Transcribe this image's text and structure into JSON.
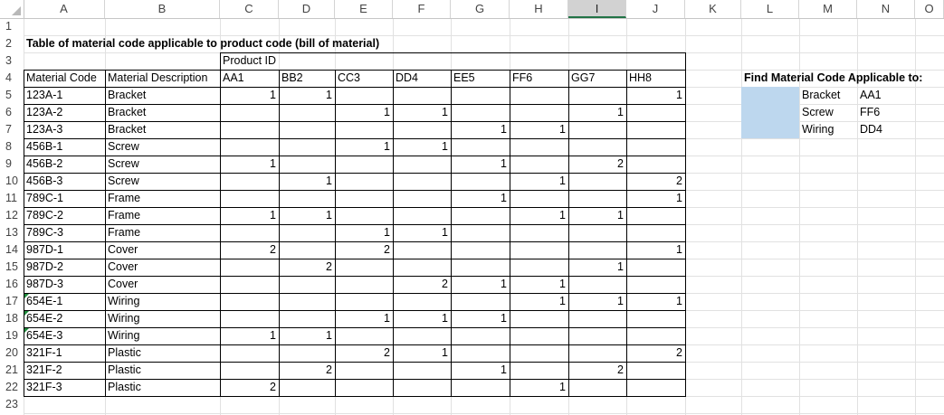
{
  "columns": [
    "A",
    "B",
    "C",
    "D",
    "E",
    "F",
    "G",
    "H",
    "I",
    "J",
    "K",
    "L",
    "M",
    "N",
    "O"
  ],
  "selected_column": "I",
  "rows": [
    "1",
    "2",
    "3",
    "4",
    "5",
    "6",
    "7",
    "8",
    "9",
    "10",
    "11",
    "12",
    "13",
    "14",
    "15",
    "16",
    "17",
    "18",
    "19",
    "20",
    "21",
    "22",
    "23"
  ],
  "title": "Table of material code applicable to product code (bill of material)",
  "product_id_label": "Product ID",
  "table_headers": [
    "Material Code",
    "Material Description",
    "AA1",
    "BB2",
    "CC3",
    "DD4",
    "EE5",
    "FF6",
    "GG7",
    "HH8"
  ],
  "table_rows": [
    [
      "123A-1",
      "Bracket",
      "1",
      "1",
      "",
      "",
      "",
      "",
      "",
      "1"
    ],
    [
      "123A-2",
      "Bracket",
      "",
      "",
      "1",
      "1",
      "",
      "",
      "1",
      ""
    ],
    [
      "123A-3",
      "Bracket",
      "",
      "",
      "",
      "",
      "1",
      "1",
      "",
      ""
    ],
    [
      "456B-1",
      "Screw",
      "",
      "",
      "1",
      "1",
      "",
      "",
      "",
      ""
    ],
    [
      "456B-2",
      "Screw",
      "1",
      "",
      "",
      "",
      "1",
      "",
      "2",
      ""
    ],
    [
      "456B-3",
      "Screw",
      "",
      "1",
      "",
      "",
      "",
      "1",
      "",
      "2"
    ],
    [
      "789C-1",
      "Frame",
      "",
      "",
      "",
      "",
      "1",
      "",
      "",
      "1"
    ],
    [
      "789C-2",
      "Frame",
      "1",
      "1",
      "",
      "",
      "",
      "1",
      "1",
      ""
    ],
    [
      "789C-3",
      "Frame",
      "",
      "",
      "1",
      "1",
      "",
      "",
      "",
      ""
    ],
    [
      "987D-1",
      "Cover",
      "2",
      "",
      "2",
      "",
      "",
      "",
      "",
      "1"
    ],
    [
      "987D-2",
      "Cover",
      "",
      "2",
      "",
      "",
      "",
      "",
      "1",
      ""
    ],
    [
      "987D-3",
      "Cover",
      "",
      "",
      "",
      "2",
      "1",
      "1",
      "",
      ""
    ],
    [
      "654E-1",
      "Wiring",
      "",
      "",
      "",
      "",
      "",
      "1",
      "1",
      "1"
    ],
    [
      "654E-2",
      "Wiring",
      "",
      "",
      "1",
      "1",
      "1",
      "",
      "",
      ""
    ],
    [
      "654E-3",
      "Wiring",
      "1",
      "1",
      "",
      "",
      "",
      "",
      "",
      ""
    ],
    [
      "321F-1",
      "Plastic",
      "",
      "",
      "2",
      "1",
      "",
      "",
      "",
      "2"
    ],
    [
      "321F-2",
      "Plastic",
      "",
      "2",
      "",
      "",
      "1",
      "",
      "2",
      ""
    ],
    [
      "321F-3",
      "Plastic",
      "2",
      "",
      "",
      "",
      "",
      "1",
      "",
      ""
    ]
  ],
  "lookup": {
    "title": "Find Material Code Applicable to:",
    "items": [
      {
        "desc": "Bracket",
        "product": "AA1"
      },
      {
        "desc": "Screw",
        "product": "FF6"
      },
      {
        "desc": "Wiring",
        "product": "DD4"
      }
    ]
  },
  "colors": {
    "lookup_fill": "#bdd7ee",
    "selected_header": "#d2d2d2",
    "accent": "#217346"
  }
}
